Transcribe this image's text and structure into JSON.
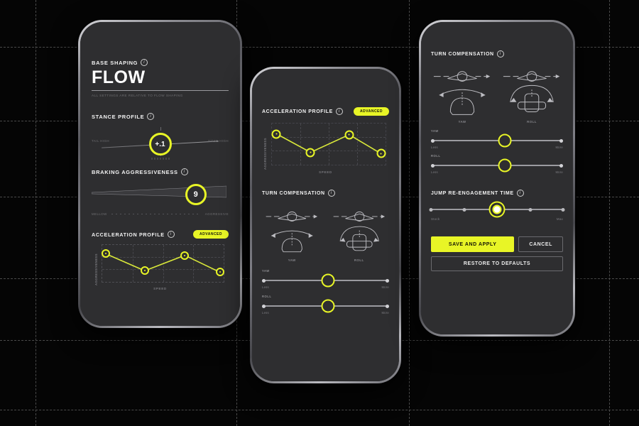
{
  "accent": "#e8f526",
  "background": "#050505",
  "screen_bg": "#2e2e30",
  "phone1": {
    "section_base_shaping": "BASE SHAPING",
    "title": "FLOW",
    "subtitle": "ALL SETTINGS ARE RELATIVE TO FLOW SHAPING",
    "section_stance": "STANCE PROFILE",
    "stance_value": "+.1",
    "stance_left": "TAIL HIGH",
    "stance_right": "NOSE HIGH",
    "section_braking": "BRAKING AGGRESSIVENESS",
    "braking_value": "9",
    "braking_left": "MELLOW",
    "braking_right": "AGGRESSIVE",
    "section_accel": "ACCELERATION PROFILE",
    "accel_badge": "ADVANCED",
    "info_glyph": "i"
  },
  "phone2": {
    "section_accel": "ACCELERATION PROFILE",
    "accel_badge": "ADVANCED",
    "section_turn": "TURN COMPENSATION",
    "diagram_yaw": "YAW",
    "diagram_roll": "ROLL",
    "slider_yaw_label": "YAW",
    "slider_roll_label": "ROLL",
    "slider_min": "Less",
    "slider_max": "More",
    "info_glyph": "i"
  },
  "phone3": {
    "section_turn": "TURN COMPENSATION",
    "diagram_yaw": "YAW",
    "diagram_roll": "ROLL",
    "slider_yaw_label": "YAW",
    "slider_roll_label": "ROLL",
    "slider_min": "Less",
    "slider_max": "More",
    "section_jump": "JUMP RE-ENGAGEMENT TIME",
    "jump_min": "Stock",
    "jump_max": "Max",
    "btn_save": "SAVE AND APPLY",
    "btn_cancel": "CANCEL",
    "btn_restore": "RESTORE TO DEFAULTS",
    "info_glyph": "i"
  },
  "chart_data": [
    {
      "id": "accel-profile-phone1",
      "type": "line",
      "title": "ACCELERATION PROFILE",
      "xlabel": "SPEED",
      "ylabel": "AGGRESSIVENESS",
      "x": [
        0,
        33,
        67,
        100
      ],
      "values": [
        76,
        30,
        72,
        26
      ],
      "xlim": [
        0,
        100
      ],
      "ylim": [
        0,
        100
      ],
      "grid": true,
      "legend": "none"
    },
    {
      "id": "accel-profile-phone2",
      "type": "line",
      "title": "ACCELERATION PROFILE",
      "xlabel": "SPEED",
      "ylabel": "AGGRESSIVENESS",
      "x": [
        0,
        33,
        67,
        100
      ],
      "values": [
        76,
        30,
        72,
        26
      ],
      "xlim": [
        0,
        100
      ],
      "ylim": [
        0,
        100
      ],
      "grid": true,
      "legend": "none"
    }
  ],
  "sliders": {
    "phone2_yaw_pct": 52,
    "phone2_roll_pct": 52,
    "phone3_yaw_pct": 56,
    "phone3_roll_pct": 56,
    "phone3_jump_pct": 50,
    "phone3_jump_notches": [
      0,
      25,
      50,
      75,
      100
    ]
  }
}
